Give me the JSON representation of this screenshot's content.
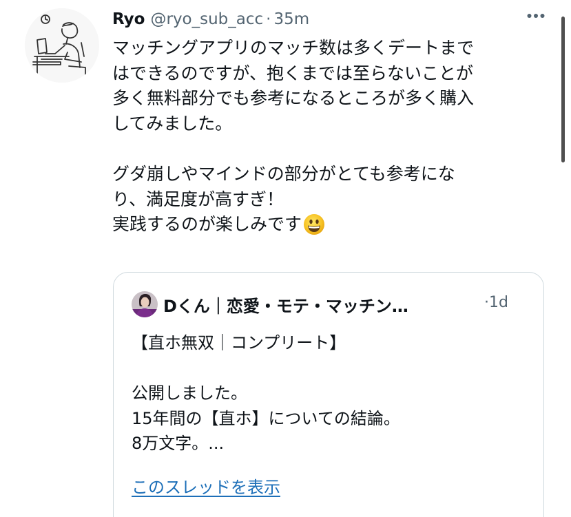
{
  "tweet": {
    "author_name": "Ryo",
    "author_handle": "@ryo_sub_acc",
    "separator": "·",
    "time": "35m",
    "avatar_icon": "person-at-desk-icon",
    "more_icon": "more-horizontal-icon",
    "text_lines": [
      "マッチングアプリのマッチ数は多くデートまで",
      "はできるのですが、抱くまでは至らないことが",
      "多く無料部分でも参考になるところが多く購入",
      "してみました。",
      "",
      "グダ崩しやマインドの部分がとても参考にな",
      "り、満足度が高すぎ！",
      "実践するのが楽しみです"
    ],
    "emoji_icon": "grinning-face-emoji-icon"
  },
  "quote": {
    "author_name": "Dくん｜恋愛・モテ・マッチン…",
    "time": "·1d",
    "avatar_icon": "user-avatar-icon",
    "text_lines": [
      "【直ホ無双｜コンプリート】",
      "",
      "公開しました。",
      "15年間の【直ホ】についての結論。",
      "8万文字。..."
    ],
    "show_thread_label": "このスレッドを表示"
  },
  "colors": {
    "text": "#0f1419",
    "secondary": "#536471",
    "link": "#1d6fb8",
    "border": "#cfd9de",
    "scrollbar": "#4f4f4f"
  }
}
